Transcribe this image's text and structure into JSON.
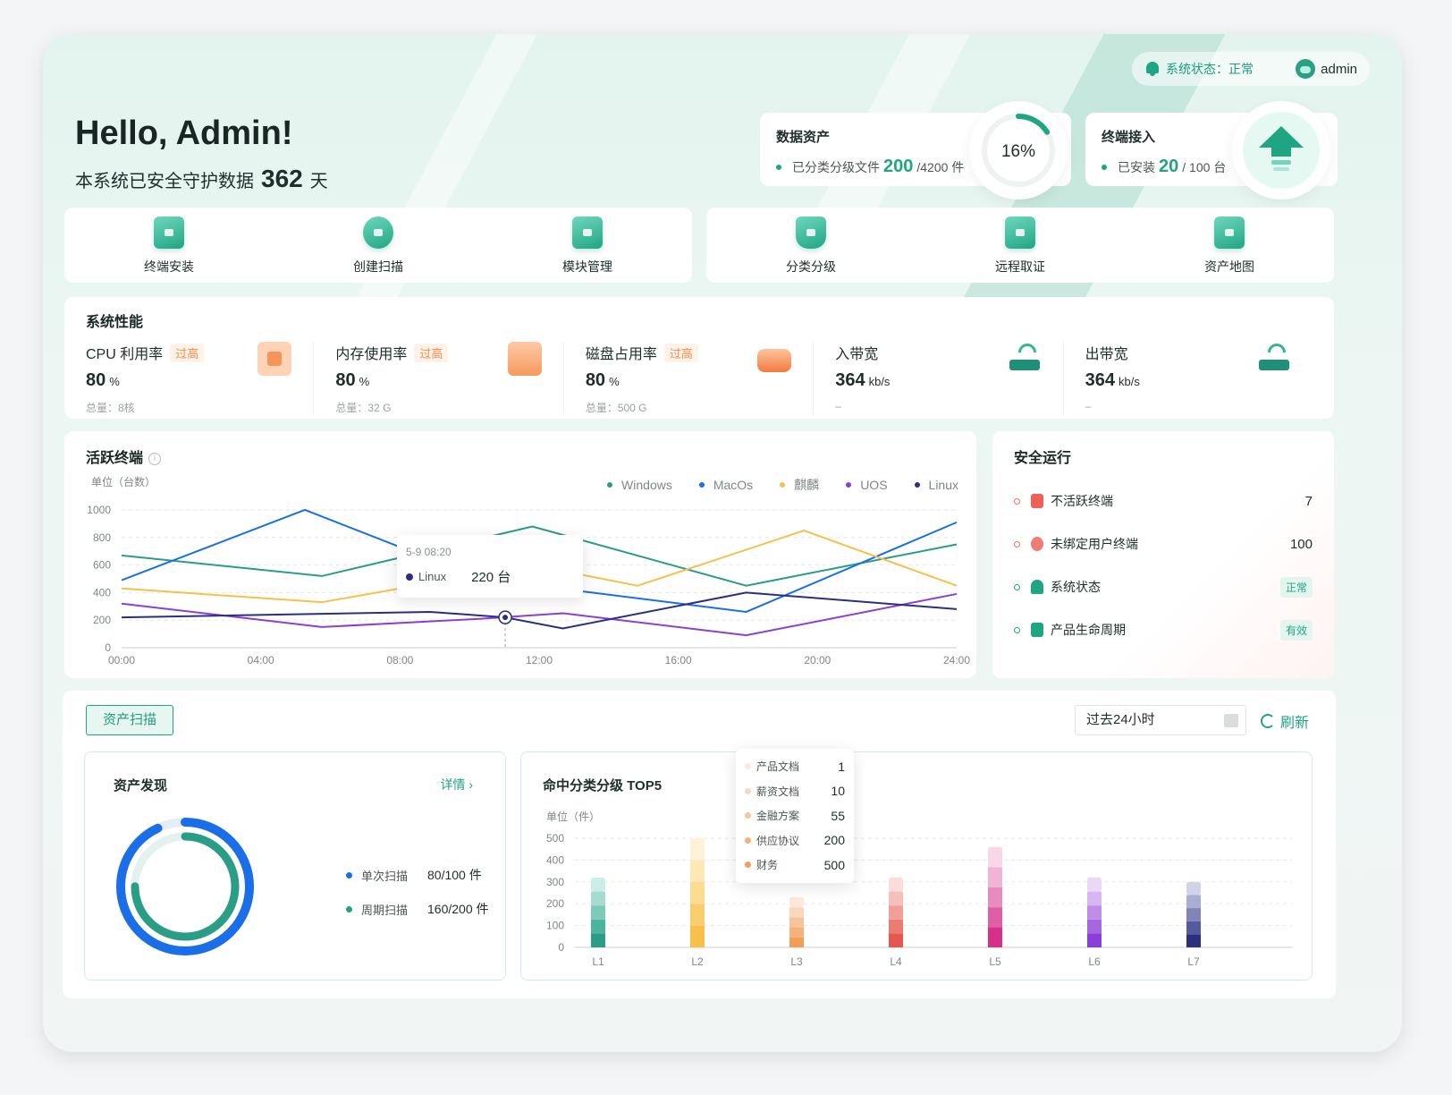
{
  "header": {
    "greeting": "Hello, Admin!",
    "guard_prefix": "本系统已安全守护数据",
    "guard_days": "362",
    "guard_suffix": "天",
    "status_label": "系统状态：正常",
    "user": "admin"
  },
  "data_assets": {
    "title": "数据资产",
    "desc": "已分类分级文件",
    "value": "200",
    "total": "/4200 件",
    "percent_label": "16%",
    "percent": 16
  },
  "terminal_access": {
    "title": "终端接入",
    "desc": "已安装",
    "value": "20",
    "total": " / 100 台"
  },
  "quick_actions_left": [
    {
      "label": "终端安装",
      "icon": "download-icon"
    },
    {
      "label": "创建扫描",
      "icon": "scan-icon"
    },
    {
      "label": "模块管理",
      "icon": "module-add-icon"
    }
  ],
  "quick_actions_right": [
    {
      "label": "分类分级",
      "icon": "bookmark-icon"
    },
    {
      "label": "远程取证",
      "icon": "monitor-icon"
    },
    {
      "label": "资产地图",
      "icon": "folder-icon"
    }
  ],
  "performance": {
    "title": "系统性能",
    "items": [
      {
        "name": "CPU 利用率",
        "warn": "过高",
        "value": "80",
        "unit": "%",
        "sub": "总量：8核",
        "icon": "cpu-icon"
      },
      {
        "name": "内存使用率",
        "warn": "过高",
        "value": "80",
        "unit": "%",
        "sub": "总量：32 G",
        "icon": "memory-icon"
      },
      {
        "name": "磁盘占用率",
        "warn": "过高",
        "value": "80",
        "unit": "%",
        "sub": "总量：500 G",
        "icon": "disk-icon"
      },
      {
        "name": "入带宽",
        "warn": "",
        "value": "364",
        "unit": "kb/s",
        "sub": "–",
        "icon": "router-icon"
      },
      {
        "name": "出带宽",
        "warn": "",
        "value": "364",
        "unit": "kb/s",
        "sub": "–",
        "icon": "router-icon"
      }
    ]
  },
  "active_terminals": {
    "title": "活跃终端",
    "info": "i",
    "unit": "单位（台数）",
    "tooltip": {
      "time": "5-9 08:20",
      "series": "Linux",
      "value": "220 台"
    }
  },
  "chart_data": {
    "type": "line",
    "x": [
      "00:00",
      "04:00",
      "08:00",
      "12:00",
      "16:00",
      "20:00",
      "24:00"
    ],
    "x_hours": [
      0,
      5.2,
      8.8,
      12,
      13.5,
      18.4,
      21.8,
      24.4
    ],
    "ylim": [
      0,
      1000
    ],
    "yticks": [
      0,
      200,
      400,
      600,
      800,
      1000
    ],
    "grid": true,
    "legend_position": "top-right",
    "series": [
      {
        "name": "Windows",
        "color": "#2a9d86",
        "points": [
          [
            0,
            670
          ],
          [
            5.9,
            520
          ],
          [
            12.1,
            880
          ],
          [
            18.4,
            450
          ],
          [
            24.6,
            750
          ]
        ]
      },
      {
        "name": "MacOs",
        "color": "#1a6ee8",
        "points": [
          [
            0,
            490
          ],
          [
            5.4,
            1000
          ],
          [
            10.6,
            500
          ],
          [
            18.4,
            260
          ],
          [
            24.6,
            910
          ]
        ]
      },
      {
        "name": "麒麟",
        "color": "#f7c04b",
        "points": [
          [
            0,
            430
          ],
          [
            5.9,
            330
          ],
          [
            12.1,
            600
          ],
          [
            15.2,
            450
          ],
          [
            20.1,
            850
          ],
          [
            24.6,
            450
          ]
        ]
      },
      {
        "name": "UOS",
        "color": "#8a3fd6",
        "points": [
          [
            0,
            320
          ],
          [
            5.9,
            150
          ],
          [
            10.6,
            210
          ],
          [
            13.0,
            250
          ],
          [
            18.4,
            90
          ],
          [
            24.6,
            390
          ]
        ]
      },
      {
        "name": "Linux",
        "color": "#2a2f80",
        "points": [
          [
            0,
            220
          ],
          [
            9.1,
            260
          ],
          [
            11.3,
            220
          ],
          [
            13.0,
            140
          ],
          [
            18.4,
            400
          ],
          [
            24.6,
            280
          ]
        ]
      }
    ],
    "highlight": {
      "series": "Linux",
      "x": 11.3,
      "y": 220
    }
  },
  "security": {
    "title": "安全运行",
    "items": [
      {
        "label": "不活跃终端",
        "value": "7",
        "kind": "number",
        "icon": "flag-icon"
      },
      {
        "label": "未绑定用户终端",
        "value": "100",
        "kind": "number",
        "icon": "user-icon"
      },
      {
        "label": "系统状态",
        "value": "正常",
        "kind": "tag",
        "icon": "bell-icon"
      },
      {
        "label": "产品生命周期",
        "value": "有效",
        "kind": "tag",
        "icon": "bolt-icon"
      }
    ]
  },
  "asset_scan": {
    "tab": "资产扫描",
    "range": "过去24小时",
    "refresh": "刷新",
    "discovery": {
      "title": "资产发现",
      "detail": "详情 ›",
      "legend": [
        {
          "label": "单次扫描",
          "value": "80/100 件",
          "color": "#1a6ee8",
          "fraction": 0.8
        },
        {
          "label": "周期扫描",
          "value": "160/200 件",
          "color": "#2a9d86",
          "fraction": 0.8
        }
      ]
    },
    "top5": {
      "title": "命中分类分级 TOP5",
      "unit": "单位（件）",
      "categories": [
        "L1",
        "L2",
        "L3",
        "L4",
        "L5",
        "L6",
        "L7"
      ],
      "yticks": [
        0,
        100,
        200,
        300,
        400,
        500
      ],
      "ylim": [
        0,
        500
      ],
      "totals": [
        320,
        500,
        230,
        320,
        460,
        320,
        300
      ],
      "palettes": [
        [
          "#2a9d86",
          "#4cb39d",
          "#7ccab7",
          "#a6dccf",
          "#cdeee6"
        ],
        [
          "#f7c04b",
          "#f9cf6e",
          "#fbdc91",
          "#fde8b6",
          "#fef2d8"
        ],
        [
          "#f29d58",
          "#f5b17a",
          "#f8c49c",
          "#fbd7be",
          "#fde8da"
        ],
        [
          "#e5584f",
          "#ec7c73",
          "#f29f98",
          "#f6bfba",
          "#fbdcd9"
        ],
        [
          "#d82f8c",
          "#e05ea6",
          "#e98bbf",
          "#f1b4d6",
          "#f8d7e9"
        ],
        [
          "#8a3fd6",
          "#a566df",
          "#bf8de8",
          "#d7b6f1",
          "#ead8f8"
        ],
        [
          "#2a2f80",
          "#545a9c",
          "#8084b8",
          "#aaaed2",
          "#d1d3e8"
        ]
      ],
      "tooltip": [
        {
          "label": "产品文档",
          "value": "1",
          "color": "#fde8da"
        },
        {
          "label": "薪资文档",
          "value": "10",
          "color": "#fbd7be"
        },
        {
          "label": "金融方案",
          "value": "55",
          "color": "#f8c49c"
        },
        {
          "label": "供应协议",
          "value": "200",
          "color": "#f5b17a"
        },
        {
          "label": "财务",
          "value": "500",
          "color": "#f29d58"
        }
      ]
    }
  }
}
